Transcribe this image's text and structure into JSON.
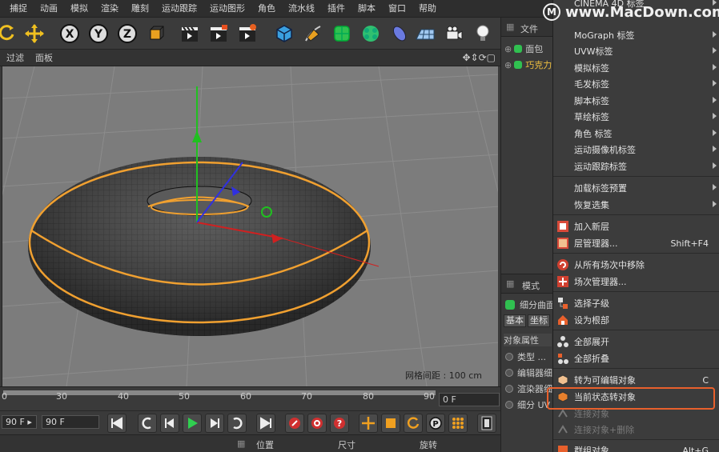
{
  "menubar": [
    "捕捉",
    "动画",
    "模拟",
    "渲染",
    "雕刻",
    "运动跟踪",
    "运动图形",
    "角色",
    "流水线",
    "插件",
    "脚本",
    "窗口",
    "帮助"
  ],
  "viewport_menu": [
    "过滤",
    "面板"
  ],
  "viewport": {
    "grid_spacing": "网格间距 : 100 cm"
  },
  "timeline": {
    "ticks": [
      "0",
      "30",
      "40",
      "50",
      "60",
      "70",
      "80",
      "90"
    ],
    "current_frame": "0 F"
  },
  "transport": {
    "start_field": "90 F ▸",
    "end_field": "90 F"
  },
  "coords": {
    "position": "位置",
    "size": "尺寸",
    "rotation": "旋转"
  },
  "object_manager": {
    "tab": "文件",
    "items": [
      "面包",
      "巧克力"
    ]
  },
  "attributes": {
    "tab": "模式",
    "object_name": "细分曲面",
    "tabs": [
      "基本",
      "坐标"
    ],
    "section": "对象属性",
    "rows": [
      "类型 ...",
      "编辑器细",
      "渲染器细",
      "细分 UV"
    ]
  },
  "context_menu": {
    "items": [
      {
        "label": "CINEMA 4D 标签",
        "submenu": true
      },
      {
        "label": "MoGraph 标签",
        "submenu": true
      },
      {
        "label": "UVW标签",
        "submenu": true
      },
      {
        "label": "模拟标签",
        "submenu": true
      },
      {
        "label": "毛发标签",
        "submenu": true
      },
      {
        "label": "脚本标签",
        "submenu": true
      },
      {
        "label": "草绘标签",
        "submenu": true
      },
      {
        "label": "角色 标签",
        "submenu": true
      },
      {
        "label": "运动摄像机标签",
        "submenu": true
      },
      {
        "label": "运动跟踪标签",
        "submenu": true
      },
      {
        "label": "加载标签预置",
        "submenu": true
      },
      {
        "label": "恢复选集",
        "submenu": true
      },
      {
        "label": "加入新层"
      },
      {
        "label": "层管理器...",
        "shortcut": "Shift+F4"
      },
      {
        "label": "从所有场次中移除"
      },
      {
        "label": "场次管理器..."
      },
      {
        "label": "选择子级"
      },
      {
        "label": "设为根部"
      },
      {
        "label": "全部展开"
      },
      {
        "label": "全部折叠"
      },
      {
        "label": "转为可编辑对象",
        "shortcut": "C"
      },
      {
        "label": "当前状态转对象"
      },
      {
        "label": "连接对象"
      },
      {
        "label": "连接对象+删除"
      },
      {
        "label": "群组对象",
        "shortcut": "Alt+G"
      }
    ]
  },
  "watermark": {
    "text": "www.MacDown.com",
    "logo": "M"
  },
  "colors": {
    "accent": "#e8602c",
    "selection": "#f0a030",
    "axis_x": "#d02020",
    "axis_y": "#20c020",
    "axis_z": "#3030e0"
  }
}
